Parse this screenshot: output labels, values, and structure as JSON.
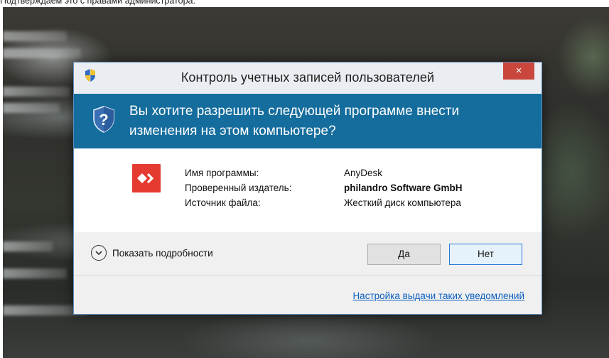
{
  "caption": "Подтверждаем это с правами администратора.",
  "dialog": {
    "title": "Контроль учетных записей пользователей",
    "close_label": "×",
    "question_line1": "Вы хотите разрешить следующей программе внести",
    "question_line2": "изменения на этом компьютере?",
    "program_label": "Имя программы:",
    "program_value": "AnyDesk",
    "publisher_label": "Проверенный издатель:",
    "publisher_value": "philandro Software GmbH",
    "source_label": "Источник файла:",
    "source_value": "Жесткий диск компьютера",
    "details_label": "Показать подробности",
    "yes_label": "Да",
    "no_label": "Нет",
    "settings_link": "Настройка выдачи таких уведомлений"
  },
  "colors": {
    "header_bg": "#156d9e",
    "close_bg": "#c9463d",
    "app_icon_bg": "#e53a30",
    "link": "#0b5fbf"
  },
  "icons": {
    "title": "uac-shield-icon",
    "header": "uac-shield-question-icon",
    "app": "anydesk-logo-icon",
    "details": "chevron-down-circle-icon"
  }
}
